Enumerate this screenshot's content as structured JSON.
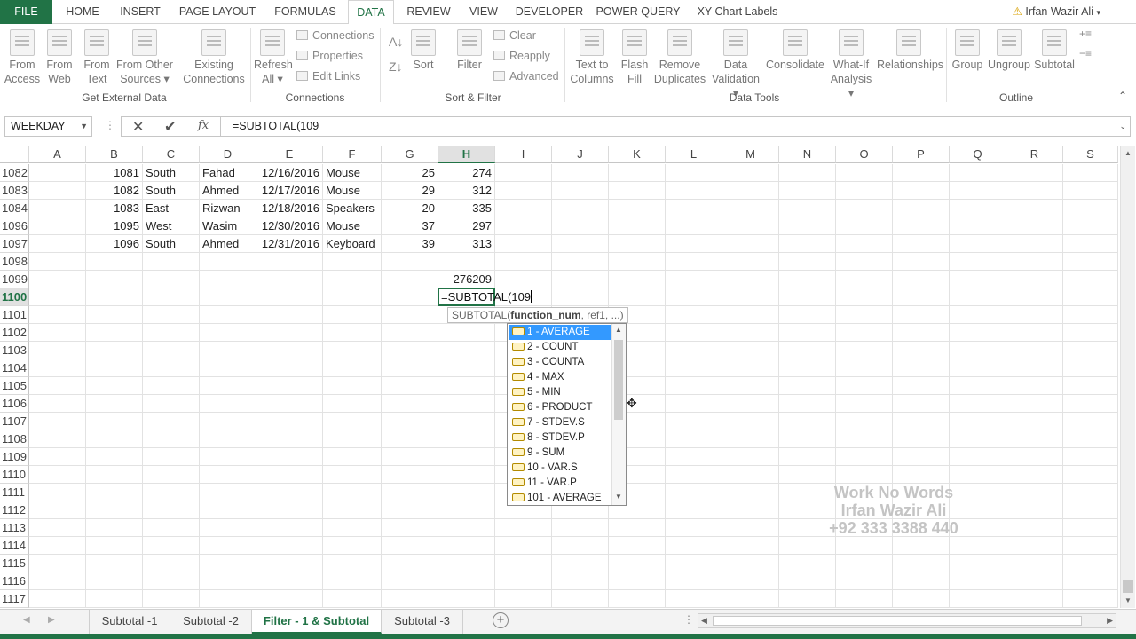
{
  "tabs": [
    "FILE",
    "HOME",
    "INSERT",
    "PAGE LAYOUT",
    "FORMULAS",
    "DATA",
    "REVIEW",
    "VIEW",
    "DEVELOPER",
    "POWER QUERY",
    "XY Chart Labels"
  ],
  "user": "Irfan Wazir Ali",
  "ribbon": {
    "from_access": [
      "From",
      "Access"
    ],
    "from_web": [
      "From",
      "Web"
    ],
    "from_text": [
      "From",
      "Text"
    ],
    "from_other": [
      "From Other",
      "Sources ▾"
    ],
    "existing": [
      "Existing",
      "Connections"
    ],
    "refresh": [
      "Refresh",
      "All ▾"
    ],
    "connections": "Connections",
    "properties": "Properties",
    "edit_links": "Edit Links",
    "sort": "Sort",
    "filter": "Filter",
    "clear": "Clear",
    "reapply": "Reapply",
    "advanced": "Advanced",
    "text_to_columns": [
      "Text to",
      "Columns"
    ],
    "flash_fill": [
      "Flash",
      "Fill"
    ],
    "remove_dup": [
      "Remove",
      "Duplicates"
    ],
    "data_validation": [
      "Data",
      "Validation ▾"
    ],
    "consolidate": "Consolidate",
    "what_if": [
      "What-If",
      "Analysis ▾"
    ],
    "relationships": "Relationships",
    "group": "Group",
    "ungroup": "Ungroup",
    "subtotal": "Subtotal",
    "groups": {
      "get_external": "Get External Data",
      "connections": "Connections",
      "sort_filter": "Sort & Filter",
      "data_tools": "Data Tools",
      "outline": "Outline"
    }
  },
  "namebox": "WEEKDAY",
  "formula": "=SUBTOTAL(109",
  "columns": [
    "A",
    "B",
    "C",
    "D",
    "E",
    "F",
    "G",
    "H",
    "I",
    "J",
    "K",
    "L",
    "M",
    "N",
    "O",
    "P",
    "Q",
    "R",
    "S"
  ],
  "rows": [
    {
      "n": "1082",
      "b": "1081",
      "c": "South",
      "d": "Fahad",
      "e": "12/16/2016",
      "f": "Mouse",
      "g": "25",
      "h": "274"
    },
    {
      "n": "1083",
      "b": "1082",
      "c": "South",
      "d": "Ahmed",
      "e": "12/17/2016",
      "f": "Mouse",
      "g": "29",
      "h": "312"
    },
    {
      "n": "1084",
      "b": "1083",
      "c": "East",
      "d": "Rizwan",
      "e": "12/18/2016",
      "f": "Speakers",
      "g": "20",
      "h": "335"
    },
    {
      "n": "1096",
      "b": "1095",
      "c": "West",
      "d": "Wasim",
      "e": "12/30/2016",
      "f": "Mouse",
      "g": "37",
      "h": "297"
    },
    {
      "n": "1097",
      "b": "1096",
      "c": "South",
      "d": "Ahmed",
      "e": "12/31/2016",
      "f": "Keyboard",
      "g": "39",
      "h": "313"
    },
    {
      "n": "1098",
      "b": "",
      "c": "",
      "d": "",
      "e": "",
      "f": "",
      "g": "",
      "h": ""
    },
    {
      "n": "1099",
      "b": "",
      "c": "",
      "d": "",
      "e": "",
      "f": "",
      "g": "",
      "h": "276209"
    },
    {
      "n": "1100",
      "b": "",
      "c": "",
      "d": "",
      "e": "",
      "f": "",
      "g": "",
      "h": ""
    },
    {
      "n": "1101",
      "b": "",
      "c": "",
      "d": "",
      "e": "",
      "f": "",
      "g": "",
      "h": ""
    },
    {
      "n": "1102",
      "b": "",
      "c": "",
      "d": "",
      "e": "",
      "f": "",
      "g": "",
      "h": ""
    },
    {
      "n": "1103",
      "b": "",
      "c": "",
      "d": "",
      "e": "",
      "f": "",
      "g": "",
      "h": ""
    },
    {
      "n": "1104",
      "b": "",
      "c": "",
      "d": "",
      "e": "",
      "f": "",
      "g": "",
      "h": ""
    },
    {
      "n": "1105",
      "b": "",
      "c": "",
      "d": "",
      "e": "",
      "f": "",
      "g": "",
      "h": ""
    },
    {
      "n": "1106",
      "b": "",
      "c": "",
      "d": "",
      "e": "",
      "f": "",
      "g": "",
      "h": ""
    },
    {
      "n": "1107",
      "b": "",
      "c": "",
      "d": "",
      "e": "",
      "f": "",
      "g": "",
      "h": ""
    },
    {
      "n": "1108",
      "b": "",
      "c": "",
      "d": "",
      "e": "",
      "f": "",
      "g": "",
      "h": ""
    },
    {
      "n": "1109",
      "b": "",
      "c": "",
      "d": "",
      "e": "",
      "f": "",
      "g": "",
      "h": ""
    },
    {
      "n": "1110",
      "b": "",
      "c": "",
      "d": "",
      "e": "",
      "f": "",
      "g": "",
      "h": ""
    },
    {
      "n": "1111",
      "b": "",
      "c": "",
      "d": "",
      "e": "",
      "f": "",
      "g": "",
      "h": ""
    },
    {
      "n": "1112",
      "b": "",
      "c": "",
      "d": "",
      "e": "",
      "f": "",
      "g": "",
      "h": ""
    },
    {
      "n": "1113",
      "b": "",
      "c": "",
      "d": "",
      "e": "",
      "f": "",
      "g": "",
      "h": ""
    },
    {
      "n": "1114",
      "b": "",
      "c": "",
      "d": "",
      "e": "",
      "f": "",
      "g": "",
      "h": ""
    },
    {
      "n": "1115",
      "b": "",
      "c": "",
      "d": "",
      "e": "",
      "f": "",
      "g": "",
      "h": ""
    },
    {
      "n": "1116",
      "b": "",
      "c": "",
      "d": "",
      "e": "",
      "f": "",
      "g": "",
      "h": ""
    },
    {
      "n": "1117",
      "b": "",
      "c": "",
      "d": "",
      "e": "",
      "f": "",
      "g": "",
      "h": ""
    }
  ],
  "active_cell_text": "=SUBTOTAL(109",
  "tooltip": {
    "fn": "SUBTOTAL(",
    "arg": "function_num",
    "rest": ", ref1, ...)"
  },
  "autocomplete": [
    "1 - AVERAGE",
    "2 - COUNT",
    "3 - COUNTA",
    "4 - MAX",
    "5 - MIN",
    "6 - PRODUCT",
    "7 - STDEV.S",
    "8 - STDEV.P",
    "9 - SUM",
    "10 - VAR.S",
    "11 - VAR.P",
    "101 - AVERAGE"
  ],
  "watermark": [
    "Work No Words",
    "Irfan Wazir Ali",
    "+92 333 3388 440"
  ],
  "sheets": [
    "Subtotal -1",
    "Subtotal -2",
    "Filter - 1 & Subtotal",
    "Subtotal -3"
  ],
  "active_sheet": "Filter - 1 & Subtotal",
  "colors": {
    "accent": "#217346",
    "selection": "#3399ff"
  }
}
